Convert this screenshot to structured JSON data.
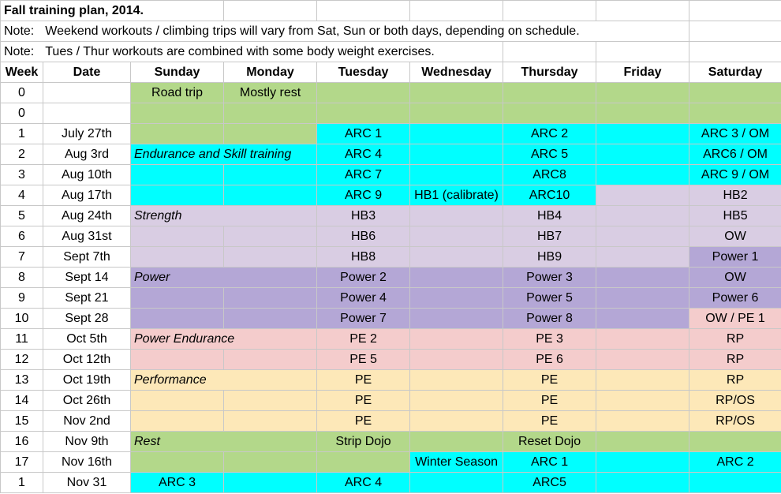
{
  "title": "Fall training plan, 2014.",
  "notes": [
    {
      "label": "Note:",
      "text": "Weekend workouts / climbing trips will vary from Sat, Sun or both days, depending on schedule."
    },
    {
      "label": "Note:",
      "text": "Tues / Thur workouts are combined with some body weight exercises."
    }
  ],
  "headers": [
    "Week",
    "Date",
    "Sunday",
    "Monday",
    "Tuesday",
    "Wednesday",
    "Thursday",
    "Friday",
    "Saturday"
  ],
  "rows": [
    {
      "week": "0",
      "date": "",
      "sun": "Road trip",
      "mon": "Mostly rest",
      "tue": "",
      "wed": "",
      "thu": "",
      "fri": "",
      "sat": ""
    },
    {
      "week": "0",
      "date": "",
      "sun": "",
      "mon": "",
      "tue": "",
      "wed": "",
      "thu": "",
      "fri": "",
      "sat": ""
    },
    {
      "week": "1",
      "date": "July 27th",
      "sun": "",
      "mon": "",
      "tue": "ARC 1",
      "wed": "",
      "thu": "ARC 2",
      "fri": "",
      "sat": "ARC 3 / OM"
    },
    {
      "week": "2",
      "date": "Aug 3rd",
      "sun": "Endurance and Skill training",
      "mon": "",
      "tue": "ARC 4",
      "wed": "",
      "thu": "ARC 5",
      "fri": "",
      "sat": "ARC6 / OM"
    },
    {
      "week": "3",
      "date": "Aug 10th",
      "sun": "",
      "mon": "",
      "tue": "ARC 7",
      "wed": "",
      "thu": "ARC8",
      "fri": "",
      "sat": "ARC 9 / OM"
    },
    {
      "week": "4",
      "date": "Aug 17th",
      "sun": "",
      "mon": "",
      "tue": "ARC 9",
      "wed": "HB1 (calibrate)",
      "thu": "ARC10",
      "fri": "",
      "sat": "HB2"
    },
    {
      "week": "5",
      "date": "Aug 24th",
      "sun": "Strength",
      "mon": "",
      "tue": "HB3",
      "wed": "",
      "thu": "HB4",
      "fri": "",
      "sat": "HB5"
    },
    {
      "week": "6",
      "date": "Aug 31st",
      "sun": "",
      "mon": "",
      "tue": "HB6",
      "wed": "",
      "thu": "HB7",
      "fri": "",
      "sat": "OW"
    },
    {
      "week": "7",
      "date": "Sept 7th",
      "sun": "",
      "mon": "",
      "tue": "HB8",
      "wed": "",
      "thu": "HB9",
      "fri": "",
      "sat": "Power 1"
    },
    {
      "week": "8",
      "date": "Sept 14",
      "sun": "Power",
      "mon": "",
      "tue": "Power 2",
      "wed": "",
      "thu": "Power 3",
      "fri": "",
      "sat": "OW"
    },
    {
      "week": "9",
      "date": "Sept 21",
      "sun": "",
      "mon": "",
      "tue": "Power 4",
      "wed": "",
      "thu": "Power 5",
      "fri": "",
      "sat": "Power 6"
    },
    {
      "week": "10",
      "date": "Sept 28",
      "sun": "",
      "mon": "",
      "tue": "Power 7",
      "wed": "",
      "thu": "Power 8",
      "fri": "",
      "sat": "OW / PE 1"
    },
    {
      "week": "11",
      "date": "Oct 5th",
      "sun": "Power Endurance",
      "mon": "",
      "tue": "PE 2",
      "wed": "",
      "thu": "PE 3",
      "fri": "",
      "sat": "RP"
    },
    {
      "week": "12",
      "date": "Oct 12th",
      "sun": "",
      "mon": "",
      "tue": "PE 5",
      "wed": "",
      "thu": "PE 6",
      "fri": "",
      "sat": "RP"
    },
    {
      "week": "13",
      "date": "Oct 19th",
      "sun": "Performance",
      "mon": "",
      "tue": "PE",
      "wed": "",
      "thu": "PE",
      "fri": "",
      "sat": "RP"
    },
    {
      "week": "14",
      "date": "Oct 26th",
      "sun": "",
      "mon": "",
      "tue": "PE",
      "wed": "",
      "thu": "PE",
      "fri": "",
      "sat": "RP/OS"
    },
    {
      "week": "15",
      "date": "Nov 2nd",
      "sun": "",
      "mon": "",
      "tue": "PE",
      "wed": "",
      "thu": "PE",
      "fri": "",
      "sat": "RP/OS"
    },
    {
      "week": "16",
      "date": "Nov 9th",
      "sun": "Rest",
      "mon": "",
      "tue": "Strip Dojo",
      "wed": "",
      "thu": "Reset Dojo",
      "fri": "",
      "sat": ""
    },
    {
      "week": "17",
      "date": "Nov 16th",
      "sun": "",
      "mon": "",
      "tue": "",
      "wed": "Winter Season",
      "thu": "ARC 1",
      "fri": "",
      "sat": "ARC 2"
    },
    {
      "week": "1",
      "date": "Nov 31",
      "sun": "ARC 3",
      "mon": "",
      "tue": "ARC 4",
      "wed": "",
      "thu": "ARC5",
      "fri": "",
      "sat": ""
    }
  ],
  "colors": {
    "rest_green": "#b3d88a",
    "endurance_cyan": "#00ffff",
    "strength_lavender": "#d9cde3",
    "power_purple": "#b4a7d6",
    "power_endurance_pink": "#f4cccc",
    "performance_peach": "#fde8b8"
  }
}
